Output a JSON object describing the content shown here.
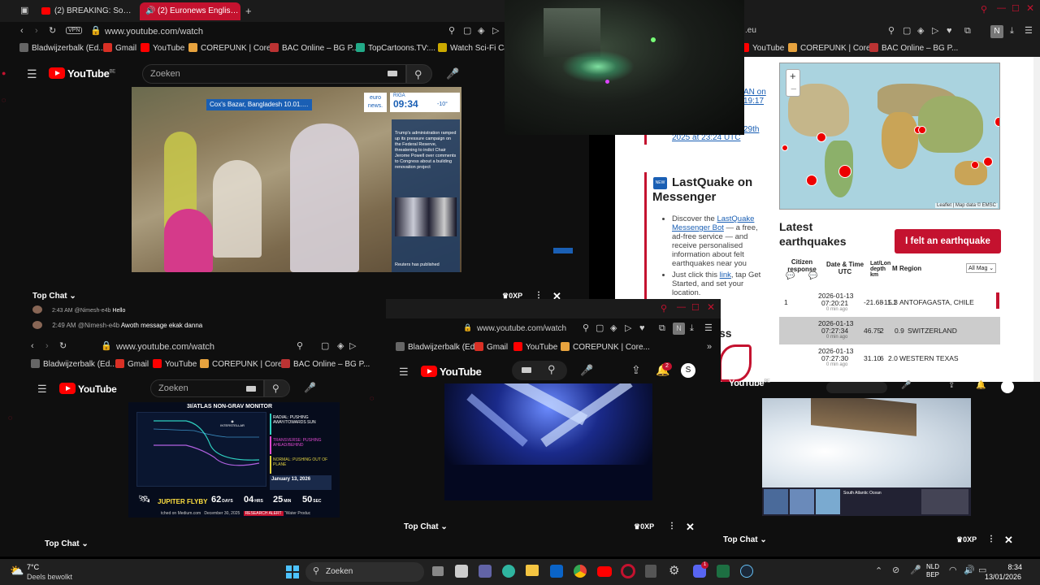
{
  "win1": {
    "tabs": [
      "(2) BREAKING: Something",
      "(2) Euronews English L"
    ],
    "url": "www.youtube.com/watch",
    "bookmarks": [
      "Bladwijzerbalk (Ed...",
      "Gmail",
      "YouTube",
      "COREPUNK | Core...",
      "BAC Online – BG P...",
      "TopCartoons.TV:...",
      "Watch Sci-Fi Cart"
    ],
    "yt_region": "BE",
    "search_placeholder": "Zoeken",
    "video": {
      "location": "Cox's Bazar, Bangladesh 10.01.2026",
      "brand": "euro news.",
      "city": "RIGA",
      "time": "09:34",
      "temp": "-10°",
      "news_text": "Trump's administration ramped up its pressure campaign on the Federal Reserve, threatening to indict Chair Jerome Powell over comments to Congress about a building renovation project",
      "news_foot": "Reuters has published"
    },
    "chat_title": "Top Chat",
    "xp": "0XP",
    "chat": [
      {
        "time": "2:43 AM",
        "user": "@Nimesh-e4b",
        "msg": "Hello"
      },
      {
        "time": "2:49 AM",
        "user": "@Nimesh-e4b",
        "msg": "Awoth message ekak danna"
      }
    ]
  },
  "win2": {
    "url": "www.youtube.com/watch",
    "bookmarks": [
      "Bladwijzerbalk (Ed...",
      "Gmail",
      "YouTube",
      "COREPUNK | Core...",
      "BAC Online – BG P..."
    ],
    "search_placeholder": "Zoeken",
    "monitor": {
      "title": "3I/ATLAS NON-GRAV MONITOR",
      "side": [
        "RADIAL: PUSHING AWAY/TOWARDS SUN",
        "TRANSVERSE: PUSHING AHEAD/BEHIND",
        "NORMAL: PUSHING OUT OF PLANE"
      ],
      "date": "January 13, 2026",
      "flyby": "JUPITER FLYBY",
      "days": "62",
      "hrs": "04",
      "min": "25",
      "sec": "50",
      "days_l": "DAYS",
      "hrs_l": "HRS",
      "min_l": "MIN",
      "sec_l": "SEC",
      "ticker": "tched on Medium.com",
      "ticker_date": "December 30, 2025",
      "alert": "RESEARCH ALERT",
      "alert_text": "\"Water Produc"
    },
    "chat_title": "Top Chat"
  },
  "win3": {
    "url": "www.youtube.com/watch",
    "bookmarks": [
      "Bladwijzerbalk (Ed...",
      "Gmail",
      "YouTube",
      "COREPUNK | Core..."
    ],
    "notif_count": "2",
    "avatar": "S",
    "chat_title": "Top Chat",
    "xp": "0XP"
  },
  "win4": {
    "bookmarks": [
      "YouTube",
      "COREPUNK | Core...",
      "BAC Online – BG P..."
    ],
    "messenger": {
      "title": "LastQuake on Messenger",
      "b1_pre": "Discover the ",
      "b1_link": "LastQuake Messenger Bot",
      "b1_post": " — a free, ad-free service — and receive personalised information about felt earthquakes near you",
      "b2_pre": "Just click this ",
      "b2_link": "link",
      "b2_post": ", tap Get Started, and set your location."
    },
    "partial_links": [
      "AN on",
      "19:17",
      "29th",
      "2025 at 23:24 UTC"
    ],
    "map_attrib": "Leaflet | Map data © EMSC",
    "latest_title": "Latest earthquakes",
    "felt_button": "I felt an earthquake",
    "headers": [
      "Citizen response",
      "Date & Time UTC",
      "Lat/Lon depth km",
      "M",
      "Region"
    ],
    "filter": "All Mag",
    "quakes": [
      {
        "resp": "1",
        "date": "2026-01-13",
        "time": "07:20:21",
        "ago": "0 min ago",
        "lat": "-21.68",
        "lon": "-11.1",
        "mag": "5.3",
        "region": "ANTOFAGASTA, CHILE"
      },
      {
        "resp": "",
        "date": "2026-01-13",
        "time": "07:27:34",
        "ago": "0 min ago",
        "lat": "46.75",
        "lon": "2",
        "mag": "0.9",
        "region": "SWITZERLAND"
      },
      {
        "resp": "",
        "date": "2026-01-13",
        "time": "07:27:30",
        "ago": "0 min ago",
        "lat": "31.10",
        "lon": "6",
        "mag": "2.0",
        "region": "WESTERN TEXAS"
      }
    ]
  },
  "win5": {
    "yt_region": "BE",
    "map_labels": [
      "South Atlantic Ocean"
    ],
    "chat_title": "Top Chat",
    "xp": "0XP"
  },
  "taskbar": {
    "temp": "7°C",
    "weather": "Deels bewolkt",
    "search": "Zoeken",
    "lang1": "NLD",
    "lang2": "BEP",
    "time": "8:34",
    "date": "13/01/2026",
    "badge": "1"
  }
}
